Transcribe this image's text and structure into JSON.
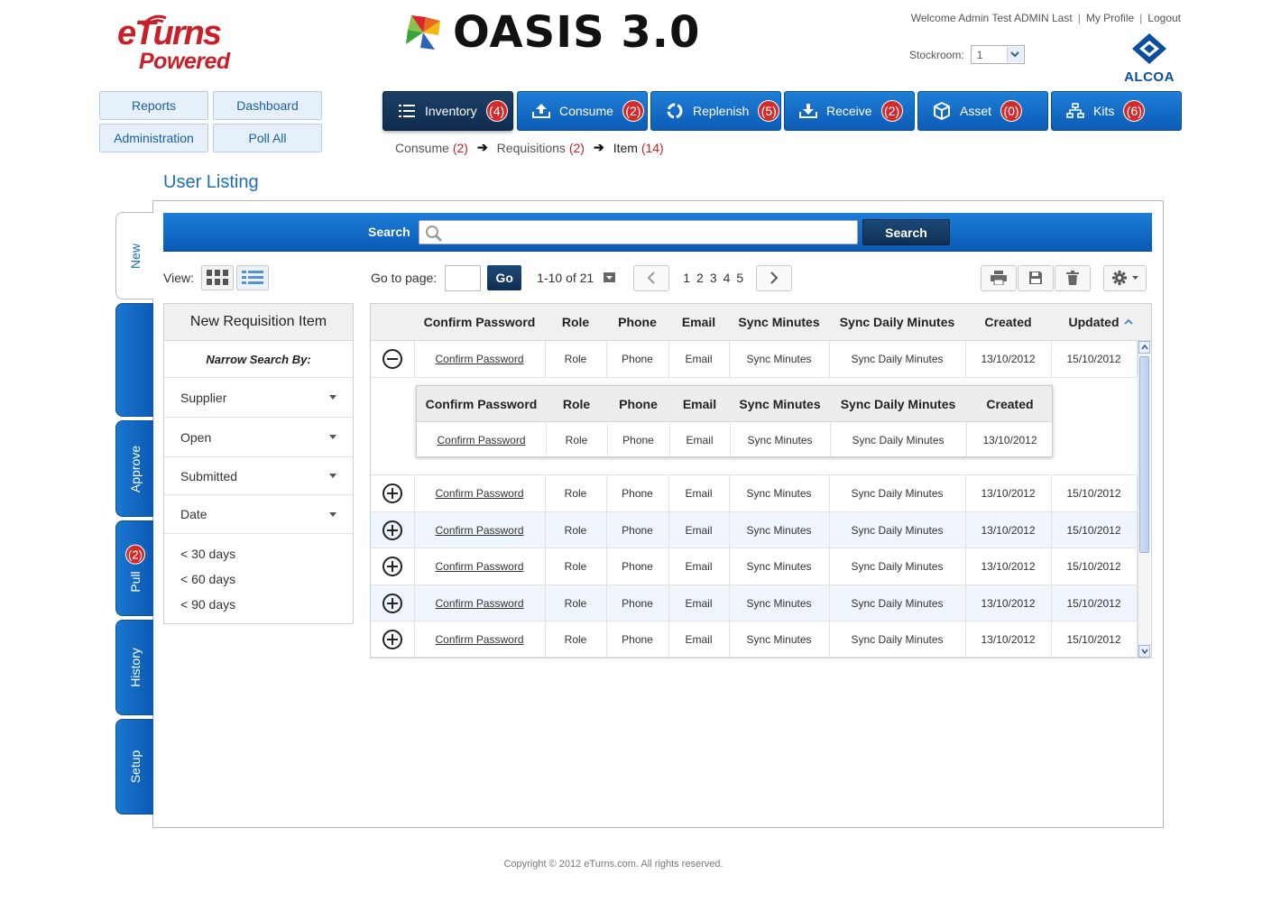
{
  "brand": {
    "left_logo_line1": "eTurns",
    "left_logo_line2": "Powered",
    "app_title": "OASIS 3.0",
    "client_logo": "ALCOA"
  },
  "top_links": {
    "welcome": "Welcome Admin Test ADMIN Last",
    "profile": "My Profile",
    "logout": "Logout",
    "separator": "|"
  },
  "stockroom": {
    "label": "Stockroom:",
    "value": "1"
  },
  "quick_buttons": [
    "Reports",
    "Dashboard",
    "Administration",
    "Poll All"
  ],
  "nav": [
    {
      "label": "Inventory",
      "count": "(4)",
      "icon": "list-icon",
      "active": true
    },
    {
      "label": "Consume",
      "count": "(2)",
      "icon": "upload-tray-icon",
      "active": false
    },
    {
      "label": "Replenish",
      "count": "(5)",
      "icon": "recycle-icon",
      "active": false
    },
    {
      "label": "Receive",
      "count": "(2)",
      "icon": "download-tray-icon",
      "active": false
    },
    {
      "label": "Asset",
      "count": "(0)",
      "icon": "cube-icon",
      "active": false
    },
    {
      "label": "Kits",
      "count": "(6)",
      "icon": "hierarchy-icon",
      "active": false
    }
  ],
  "breadcrumb": [
    {
      "label": "Consume",
      "count": "(2)"
    },
    {
      "label": "Requisitions",
      "count": "(2)"
    },
    {
      "label": "Item",
      "count": "(14)"
    }
  ],
  "page_title": "User Listing",
  "side_tabs": [
    {
      "label": "New",
      "badge": ""
    },
    {
      "label": "",
      "badge": ""
    },
    {
      "label": "Approve",
      "badge": ""
    },
    {
      "label": "Pull",
      "badge": "(2)"
    },
    {
      "label": "History",
      "badge": ""
    },
    {
      "label": "Setup",
      "badge": ""
    }
  ],
  "search": {
    "label": "Search",
    "placeholder": "",
    "button": "Search"
  },
  "toolbar": {
    "view_label": "View:",
    "goto_label": "Go to page:",
    "go_button": "Go",
    "range": "1-10 of 21",
    "pages": [
      "1",
      "2",
      "3",
      "4",
      "5"
    ],
    "prev_icon": "chevron-left-icon",
    "next_icon": "chevron-right-icon"
  },
  "filter": {
    "title": "New Requisition Item",
    "narrow": "Narrow Search By:",
    "dropdowns": [
      "Supplier",
      "Open",
      "Submitted",
      "Date"
    ],
    "date_options": [
      "< 30 days",
      "< 60 days",
      "< 90 days"
    ]
  },
  "grid": {
    "columns": [
      "Confirm Password",
      "Role",
      "Phone",
      "Email",
      "Sync Minutes",
      "Sync Daily Minutes",
      "Created",
      "Updated"
    ],
    "rows": [
      {
        "expanded": true,
        "cells": [
          "Confirm Password",
          "Role",
          "Phone",
          "Email",
          "Sync Minutes",
          "Sync Daily Minutes",
          "13/10/2012",
          "15/10/2012"
        ]
      },
      {
        "expanded": false,
        "cells": [
          "Confirm Password",
          "Role",
          "Phone",
          "Email",
          "Sync Minutes",
          "Sync Daily Minutes",
          "13/10/2012",
          "15/10/2012"
        ]
      },
      {
        "expanded": false,
        "cells": [
          "Confirm Password",
          "Role",
          "Phone",
          "Email",
          "Sync Minutes",
          "Sync Daily Minutes",
          "13/10/2012",
          "15/10/2012"
        ]
      },
      {
        "expanded": false,
        "cells": [
          "Confirm Password",
          "Role",
          "Phone",
          "Email",
          "Sync Minutes",
          "Sync Daily Minutes",
          "13/10/2012",
          "15/10/2012"
        ]
      },
      {
        "expanded": false,
        "cells": [
          "Confirm Password",
          "Role",
          "Phone",
          "Email",
          "Sync Minutes",
          "Sync Daily Minutes",
          "13/10/2012",
          "15/10/2012"
        ]
      },
      {
        "expanded": false,
        "cells": [
          "Confirm Password",
          "Role",
          "Phone",
          "Email",
          "Sync Minutes",
          "Sync Daily Minutes",
          "13/10/2012",
          "15/10/2012"
        ]
      }
    ],
    "subtable": {
      "columns": [
        "Confirm Password",
        "Role",
        "Phone",
        "Email",
        "Sync Minutes",
        "Sync Daily Minutes",
        "Created"
      ],
      "row": [
        "Confirm Password",
        "Role",
        "Phone",
        "Email",
        "Sync Minutes",
        "Sync Daily Minutes",
        "13/10/2012"
      ]
    }
  },
  "footer": "Copyright © 2012 eTurns.com. All rights reserved.",
  "colors": {
    "nav_blue": "#0b5cb6",
    "nav_active": "#0f2c4e",
    "badge_red": "#d12c2c",
    "title_blue": "#1a6fb7",
    "row_alt": "#eef5fc"
  }
}
